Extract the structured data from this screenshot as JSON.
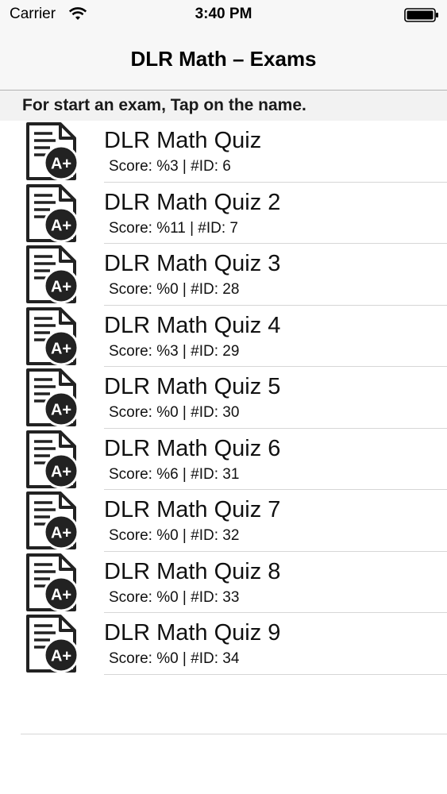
{
  "status_bar": {
    "carrier": "Carrier",
    "time": "3:40 PM"
  },
  "nav": {
    "title": "DLR Math – Exams"
  },
  "instruction": "For start an exam, Tap on the name.",
  "exam_icon": {
    "badge_text": "A+"
  },
  "exams": [
    {
      "name": "DLR Math Quiz",
      "meta": "Score: %3 |  #ID: 6"
    },
    {
      "name": "DLR Math Quiz 2",
      "meta": "Score: %11 |  #ID: 7"
    },
    {
      "name": "DLR Math Quiz 3",
      "meta": "Score: %0 |  #ID: 28"
    },
    {
      "name": "DLR Math Quiz 4",
      "meta": "Score: %3 |  #ID: 29"
    },
    {
      "name": "DLR Math Quiz 5",
      "meta": "Score: %0 |  #ID: 30"
    },
    {
      "name": "DLR Math Quiz 6",
      "meta": "Score: %6 |  #ID: 31"
    },
    {
      "name": "DLR Math Quiz 7",
      "meta": "Score: %0 |  #ID: 32"
    },
    {
      "name": "DLR Math Quiz 8",
      "meta": "Score: %0 |  #ID: 33"
    },
    {
      "name": "DLR Math Quiz 9",
      "meta": "Score: %0 |  #ID: 34"
    }
  ]
}
